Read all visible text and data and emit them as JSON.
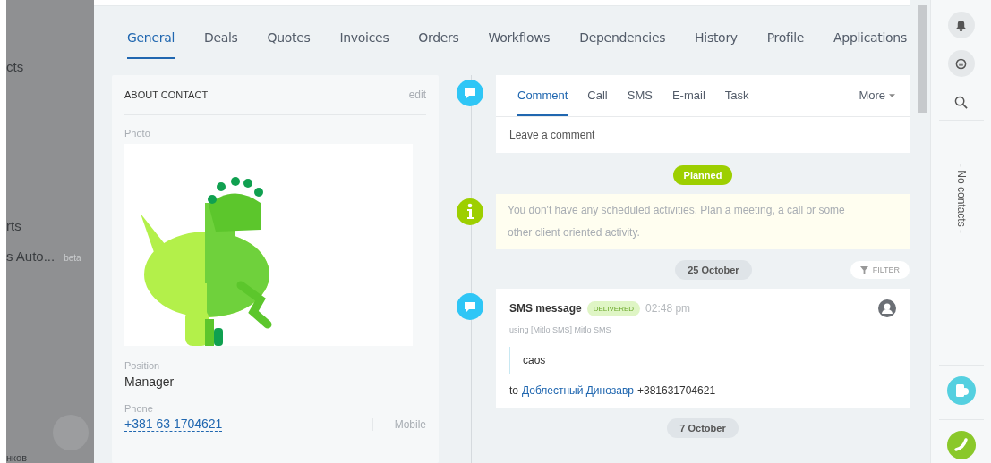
{
  "sidebar": {
    "items": [
      {
        "label": "cts"
      },
      {
        "label": "rts"
      },
      {
        "label": "s Auto...",
        "badge": "beta"
      }
    ],
    "user_name": "нков"
  },
  "tabs": [
    {
      "label": "General",
      "selected": true
    },
    {
      "label": "Deals",
      "selected": false
    },
    {
      "label": "Quotes",
      "selected": false
    },
    {
      "label": "Invoices",
      "selected": false
    },
    {
      "label": "Orders",
      "selected": false
    },
    {
      "label": "Workflows",
      "selected": false
    },
    {
      "label": "Dependencies",
      "selected": false
    },
    {
      "label": "History",
      "selected": false
    },
    {
      "label": "Profile",
      "selected": false
    },
    {
      "label": "Applications",
      "selected": false
    }
  ],
  "about_contact": {
    "title": "ABOUT CONTACT",
    "edit": "edit",
    "photo_label": "Photo",
    "fields": [
      {
        "label": "Position",
        "value": "Manager",
        "kind": "text"
      },
      {
        "label": "Phone",
        "value": "+381 63 1704621",
        "kind": "phone",
        "type": "Mobile"
      }
    ]
  },
  "composer": {
    "tabs": [
      {
        "label": "Comment",
        "selected": true
      },
      {
        "label": "Call",
        "selected": false
      },
      {
        "label": "SMS",
        "selected": false
      },
      {
        "label": "E-mail",
        "selected": false
      },
      {
        "label": "Task",
        "selected": false
      }
    ],
    "more": "More",
    "placeholder": "Leave a comment"
  },
  "timeline": {
    "planned": "Planned",
    "notice": "You don't have any scheduled activities. Plan a meeting, a call or some other client oriented activity.",
    "date": "25 October",
    "filter": "FILTER",
    "event": {
      "title": "SMS message",
      "status": "DELIVERED",
      "time": "02:48 pm",
      "via": "using [Mitlo SMS] Mitlo SMS",
      "body": "caos",
      "to": "to",
      "recipient": "Доблестный Динозавр",
      "number": "+381631704621"
    },
    "next_date": "7 October"
  },
  "right_rail": {
    "contacts": "- No contacts -"
  }
}
